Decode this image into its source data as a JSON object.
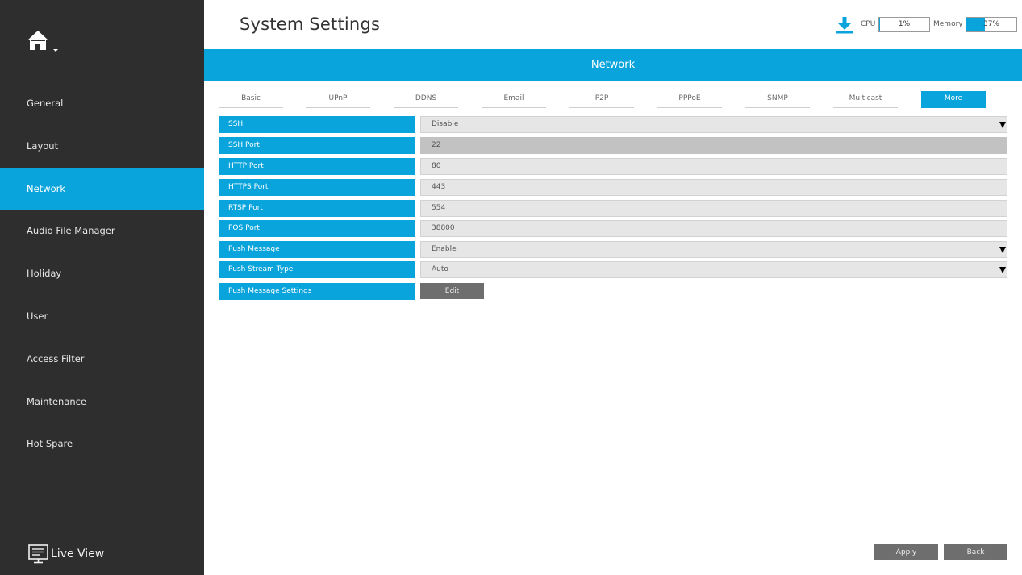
{
  "sidebar": {
    "home_icon": "home-icon",
    "items": [
      {
        "label": "General",
        "active": false
      },
      {
        "label": "Layout",
        "active": false
      },
      {
        "label": "Network",
        "active": true
      },
      {
        "label": "Audio File Manager",
        "active": false
      },
      {
        "label": "Holiday",
        "active": false
      },
      {
        "label": "User",
        "active": false
      },
      {
        "label": "Access Filter",
        "active": false
      },
      {
        "label": "Maintenance",
        "active": false
      },
      {
        "label": "Hot Spare",
        "active": false
      }
    ],
    "live_view_label": "Live View",
    "live_view_icon": "monitor-icon"
  },
  "header": {
    "title": "System Settings",
    "download_icon": "download-icon",
    "cpu_label": "CPU",
    "cpu_value": "1%",
    "cpu_fraction": 0.01,
    "memory_label": "Memory",
    "memory_value": "37%",
    "memory_fraction": 0.37
  },
  "section": {
    "title": "Network"
  },
  "tabs": [
    {
      "label": "Basic",
      "active": false
    },
    {
      "label": "UPnP",
      "active": false
    },
    {
      "label": "DDNS",
      "active": false
    },
    {
      "label": "Email",
      "active": false
    },
    {
      "label": "P2P",
      "active": false
    },
    {
      "label": "PPPoE",
      "active": false
    },
    {
      "label": "SNMP",
      "active": false
    },
    {
      "label": "Multicast",
      "active": false
    },
    {
      "label": "More",
      "active": true
    }
  ],
  "form": {
    "ssh": {
      "label": "SSH",
      "value": "Disable"
    },
    "ssh_port": {
      "label": "SSH Port",
      "value": "22"
    },
    "http_port": {
      "label": "HTTP Port",
      "value": "80"
    },
    "https_port": {
      "label": "HTTPS Port",
      "value": "443"
    },
    "rtsp_port": {
      "label": "RTSP Port",
      "value": "554"
    },
    "pos_port": {
      "label": "POS Port",
      "value": "38800"
    },
    "push_message": {
      "label": "Push Message",
      "value": "Enable"
    },
    "push_stream_type": {
      "label": "Push Stream Type",
      "value": "Auto"
    },
    "push_message_settings": {
      "label": "Push Message Settings",
      "button": "Edit"
    }
  },
  "footer": {
    "apply_label": "Apply",
    "back_label": "Back"
  },
  "colors": {
    "accent": "#0aa4dc",
    "sidebar_bg": "#2e2e2e",
    "button_bg": "#6e6e6e"
  }
}
